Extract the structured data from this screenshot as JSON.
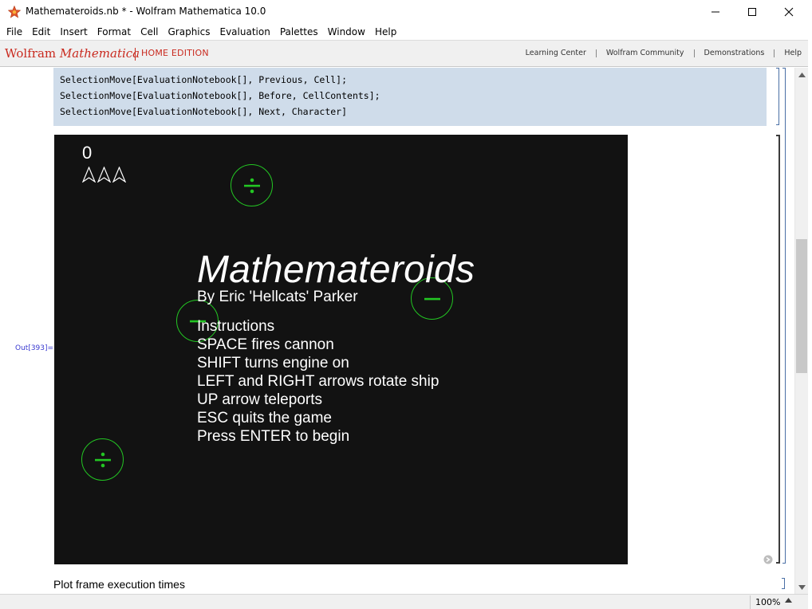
{
  "window": {
    "title": "Mathemateroids.nb * - Wolfram Mathematica 10.0",
    "minimize_icon": "minimize-icon",
    "maximize_icon": "maximize-icon",
    "close_icon": "close-icon"
  },
  "menubar": {
    "items": [
      "File",
      "Edit",
      "Insert",
      "Format",
      "Cell",
      "Graphics",
      "Evaluation",
      "Palettes",
      "Window",
      "Help"
    ]
  },
  "brandbar": {
    "brand_prefix": "Wolfram",
    "brand_name": "Mathematica",
    "edition": "HOME EDITION",
    "links": [
      "Learning Center",
      "Wolfram Community",
      "Demonstrations",
      "Help"
    ]
  },
  "input_cell": {
    "lines": [
      "SelectionMove[EvaluationNotebook[], Previous, Cell];",
      "SelectionMove[EvaluationNotebook[], Before, CellContents];",
      "SelectionMove[EvaluationNotebook[], Next, Character]"
    ]
  },
  "output_cell": {
    "label": "Out[393]="
  },
  "game": {
    "score": "0",
    "lives": 3,
    "title": "Mathemateroids",
    "author": "By Eric 'Hellcats' Parker",
    "instructions": [
      "Instructions",
      "SPACE fires cannon",
      "SHIFT turns engine on",
      "LEFT and RIGHT arrows rotate ship",
      "UP arrow teleports",
      "ESC quits the game",
      "Press ENTER to begin"
    ],
    "asteroids": [
      {
        "symbol": "divide-icon"
      },
      {
        "symbol": "minus-icon"
      },
      {
        "symbol": "minus-icon"
      },
      {
        "symbol": "divide-icon"
      }
    ],
    "colors": {
      "background": "#121212",
      "asteroid": "#23c623",
      "text": "#ffffff"
    }
  },
  "next_cell": {
    "text": "Plot frame execution times"
  },
  "statusbar": {
    "zoom": "100%"
  },
  "colors": {
    "brand_red": "#c92a1f",
    "input_cell_bg": "#cfdcea",
    "out_label": "#3a3ad0"
  }
}
